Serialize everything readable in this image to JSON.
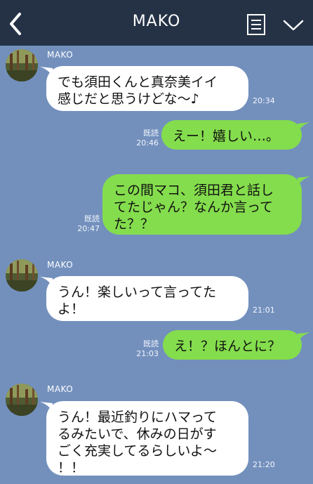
{
  "header": {
    "title": "MAKO",
    "back_icon": "chevron-left-icon",
    "notes_icon": "notes-icon",
    "menu_icon": "chevron-down-icon"
  },
  "colors": {
    "header_bg": "#253246",
    "chat_bg": "#7390bd",
    "outgoing_bubble": "#84dd4d",
    "incoming_bubble": "#ffffff"
  },
  "messages": [
    {
      "from": "MAKO",
      "direction": "incoming",
      "text": "でも須田くんと真奈美イイ\n感じだと思うけどな〜♪",
      "time": "20:34"
    },
    {
      "from": "me",
      "direction": "outgoing",
      "text": "えー！嬉しい…。",
      "read": "既読",
      "time": "20:46"
    },
    {
      "from": "me",
      "direction": "outgoing",
      "text": "この間マコ、須田君と話し\nてたじゃん？なんか言って\nた？？",
      "read": "既読",
      "time": "20:47"
    },
    {
      "from": "MAKO",
      "direction": "incoming",
      "text": "うん！楽しいって言ってた\nよ！",
      "time": "21:01"
    },
    {
      "from": "me",
      "direction": "outgoing",
      "text": "え！？ほんとに？",
      "read": "既読",
      "time": "21:03"
    },
    {
      "from": "MAKO",
      "direction": "incoming",
      "text": "うん！最近釣りにハマって\nるみたいで、休みの日がす\nごく充実してるらしいよ〜\n！！",
      "time": "21:20"
    }
  ]
}
